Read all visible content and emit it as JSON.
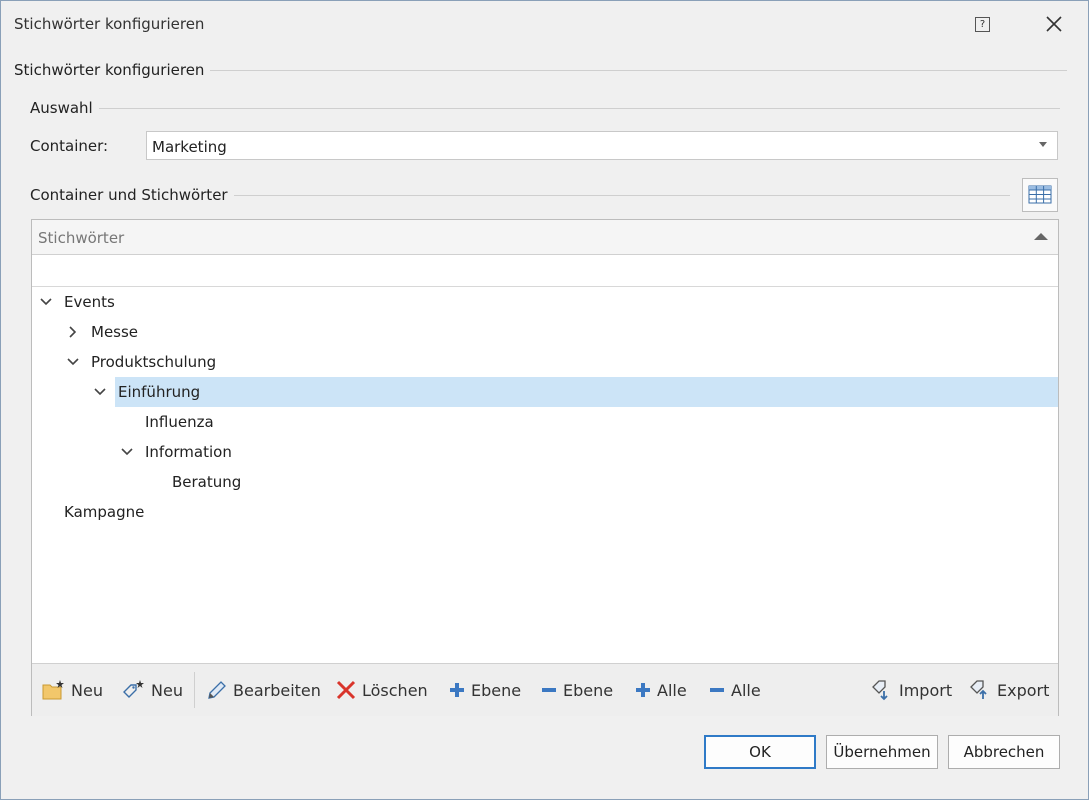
{
  "window": {
    "title": "Stichwörter konfigurieren",
    "help_glyph": "?"
  },
  "group_title": "Stichwörter konfigurieren",
  "selection": {
    "title": "Auswahl",
    "container_label": "Container:",
    "container_value": "Marketing"
  },
  "tree_section": {
    "title": "Container und Stichwörter",
    "column_header": "Stichwörter",
    "nodes": [
      {
        "label": "Events",
        "level": 0,
        "state": "expanded"
      },
      {
        "label": "Messe",
        "level": 1,
        "state": "collapsed"
      },
      {
        "label": "Produktschulung",
        "level": 1,
        "state": "expanded"
      },
      {
        "label": "Einführung",
        "level": 2,
        "state": "expanded",
        "selected": true
      },
      {
        "label": "Influenza",
        "level": 3,
        "state": "leaf"
      },
      {
        "label": "Information",
        "level": 3,
        "state": "expanded"
      },
      {
        "label": "Beratung",
        "level": 4,
        "state": "leaf"
      },
      {
        "label": "Kampagne",
        "level": 0,
        "state": "leaf"
      }
    ]
  },
  "toolbar": {
    "new_container": "Neu",
    "new_keyword": "Neu",
    "edit": "Bearbeiten",
    "delete": "Löschen",
    "expand_level": "Ebene",
    "collapse_level": "Ebene",
    "expand_all": "Alle",
    "collapse_all": "Alle",
    "import": "Import",
    "export": "Export"
  },
  "buttons": {
    "ok": "OK",
    "apply": "Übernehmen",
    "cancel": "Abbrechen"
  },
  "colors": {
    "selection": "#cce4f7",
    "accent": "#2f7ac7",
    "delete": "#d9342b",
    "plus_minus": "#3b78c2"
  }
}
